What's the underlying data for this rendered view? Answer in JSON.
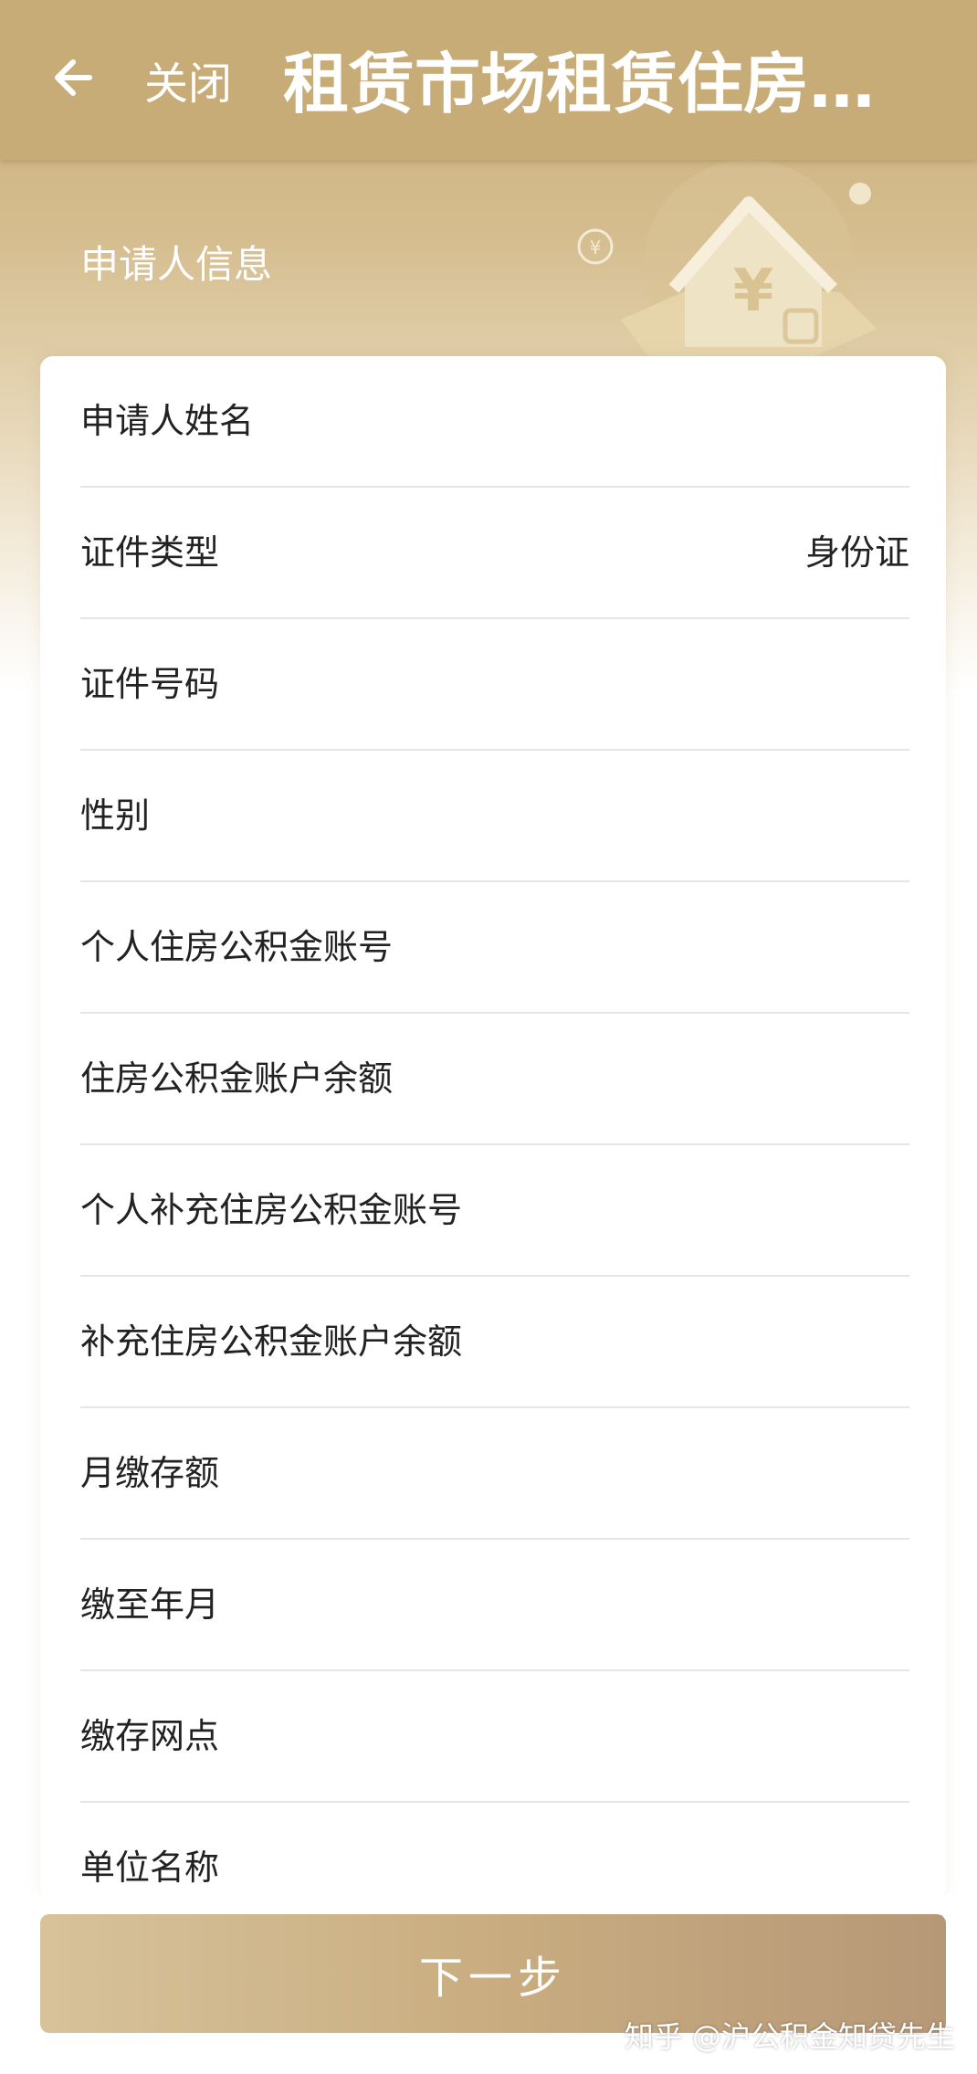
{
  "header": {
    "back_icon": "arrow-left-icon",
    "close_label": "关闭",
    "title": "租赁市场租赁住房提..."
  },
  "section": {
    "title": "申请人信息",
    "illustration_icon": "house-yuan-icon"
  },
  "form": {
    "rows": [
      {
        "label": "申请人姓名",
        "value": ""
      },
      {
        "label": "证件类型",
        "value": "身份证"
      },
      {
        "label": "证件号码",
        "value": ""
      },
      {
        "label": "性别",
        "value": ""
      },
      {
        "label": "个人住房公积金账号",
        "value": ""
      },
      {
        "label": "住房公积金账户余额",
        "value": ""
      },
      {
        "label": "个人补充住房公积金账号",
        "value": ""
      },
      {
        "label": "补充住房公积金账户余额",
        "value": ""
      },
      {
        "label": "月缴存额",
        "value": ""
      },
      {
        "label": "缴至年月",
        "value": ""
      },
      {
        "label": "缴存网点",
        "value": ""
      },
      {
        "label": "单位名称",
        "value": ""
      }
    ]
  },
  "footer": {
    "next_label": "下一步",
    "watermark": "知乎 @沪公积金知贷先生"
  },
  "colors": {
    "header_bg": "#c8ac78",
    "accent_gold": "#c9ad80",
    "text": "#222222",
    "divider": "#e6e6e6"
  }
}
